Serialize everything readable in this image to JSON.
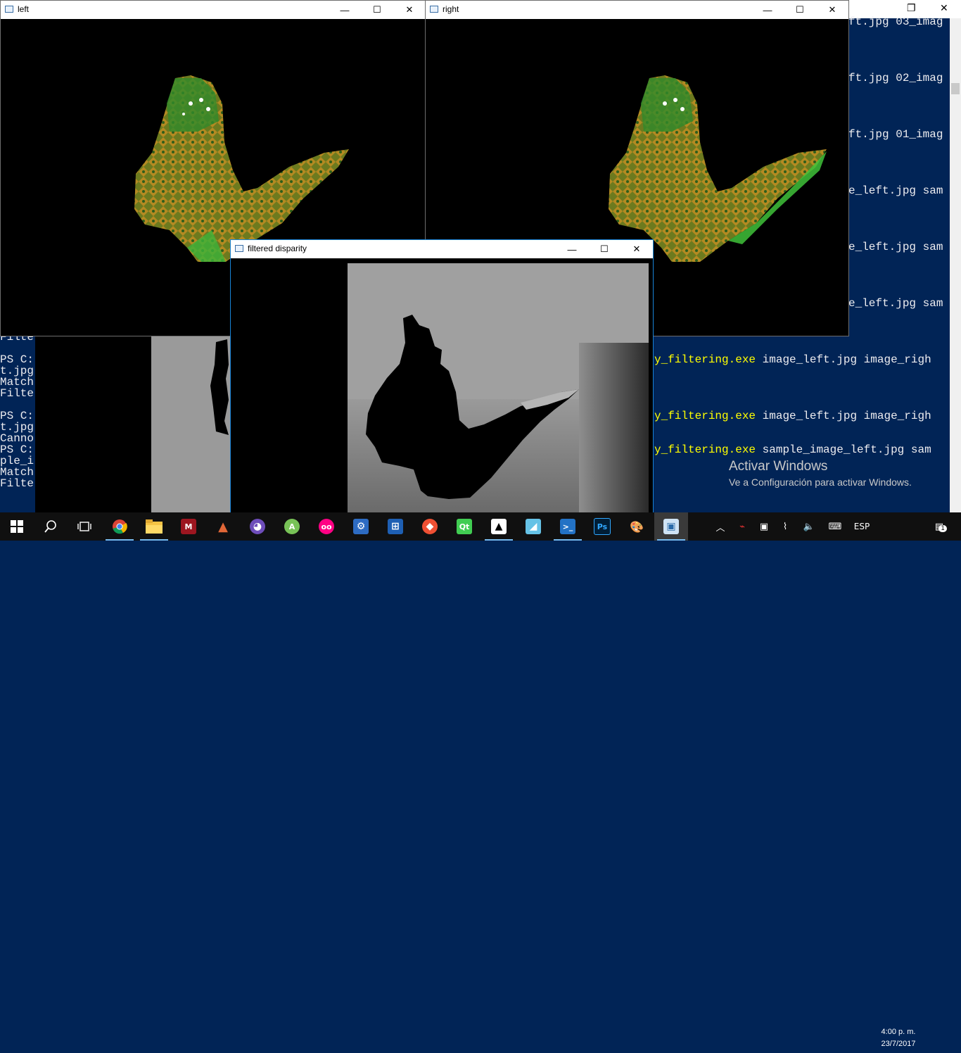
{
  "powershell": {
    "right_lines": [
      "ft.jpg 03_imag",
      "ft.jpg 02_imag",
      "ft.jpg 01_imag",
      "e_left.jpg sam",
      "e_left.jpg sam",
      "e_left.jpg sam"
    ],
    "cmd_lines": [
      {
        "exe": "y_filtering.exe",
        "args": " image_left.jpg image_righ"
      },
      {
        "exe": "y_filtering.exe",
        "args": " image_left.jpg image_righ"
      },
      {
        "exe": "y_filtering.exe",
        "args": " sample_image_left.jpg sam"
      }
    ],
    "left_lines": [
      "Filte",
      "",
      "PS C:",
      "t.jpg",
      "Match",
      "Filte",
      "",
      "PS C:",
      "t.jpg",
      "Canno",
      "PS C:",
      "ple_i",
      "Match",
      "Filte"
    ],
    "restore_symbol": "❐",
    "close_symbol": "✕"
  },
  "windows": {
    "left": {
      "title": "left"
    },
    "right": {
      "title": "right"
    },
    "disparity": {
      "title": "filtered disparity"
    }
  },
  "window_controls": {
    "minimize": "—",
    "maximize": "☐",
    "close": "✕"
  },
  "watermark": {
    "title": "Activar Windows",
    "subtitle": "Ve a Configuración para activar Windows."
  },
  "taskbar": {
    "apps": [
      {
        "name": "chrome",
        "label": "",
        "color": "#dd4b39"
      },
      {
        "name": "file-explorer",
        "label": "",
        "color": "#f6c344"
      },
      {
        "name": "mendeley",
        "label": "M",
        "color": "#9d1620"
      },
      {
        "name": "matlab",
        "label": "▲",
        "color": "#e16737"
      },
      {
        "name": "github",
        "label": "◕",
        "color": "#6e4dba"
      },
      {
        "name": "android-studio",
        "label": "A",
        "color": "#78c257"
      },
      {
        "name": "flickr",
        "label": "oo",
        "color": "#ff0084"
      },
      {
        "name": "network-app",
        "label": "⚙",
        "color": "#2d6bc2"
      },
      {
        "name": "remote-app",
        "label": "⊞",
        "color": "#1e5fb3"
      },
      {
        "name": "git-app",
        "label": "◆",
        "color": "#f05033"
      },
      {
        "name": "qt-creator",
        "label": "Qt",
        "color": "#41cd52"
      },
      {
        "name": "photos",
        "label": "▲",
        "color": "#ffffff"
      },
      {
        "name": "notes-app",
        "label": "◢",
        "color": "#66c2e6"
      },
      {
        "name": "powershell",
        "label": ">_",
        "color": "#2372c5"
      },
      {
        "name": "photoshop",
        "label": "Ps",
        "color": "#001e36"
      },
      {
        "name": "paint",
        "label": "🎨",
        "color": "#6bb3e0"
      },
      {
        "name": "opencv-window",
        "label": "▣",
        "color": "#cfe3f5"
      }
    ],
    "tray": {
      "language": "ESP",
      "time": "4:00 p. m.",
      "date": "23/7/2017",
      "notifications": "1"
    }
  }
}
